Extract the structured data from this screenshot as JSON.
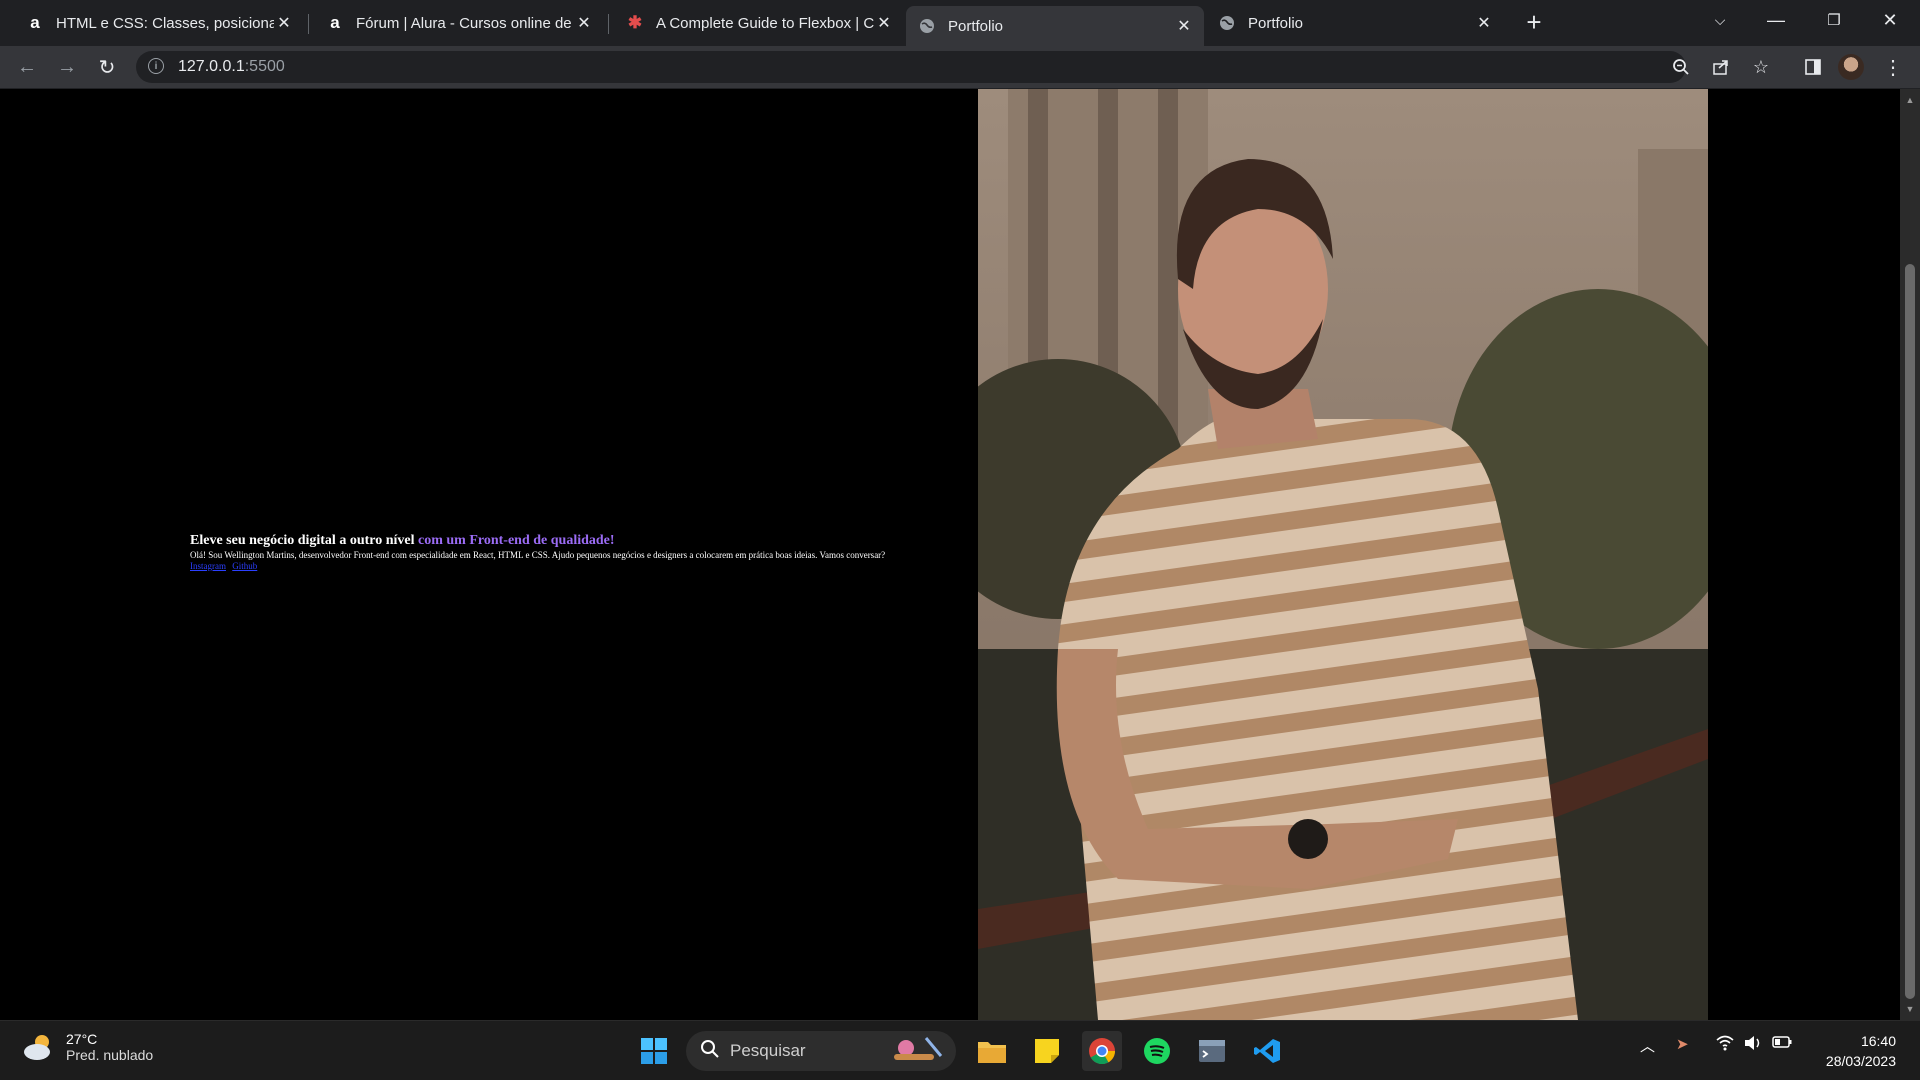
{
  "browser": {
    "tabs": [
      {
        "title": "HTML e CSS: Classes, posicionam",
        "icon": "alura-icon"
      },
      {
        "title": "Fórum | Alura - Cursos online de",
        "icon": "alura-icon"
      },
      {
        "title": "A Complete Guide to Flexbox | C",
        "icon": "css-tricks-icon"
      },
      {
        "title": "Portfolio",
        "icon": "globe-icon",
        "active": true
      },
      {
        "title": "Portfolio",
        "icon": "globe-icon"
      }
    ],
    "address": {
      "host": "127.0.0.1",
      "port": ":5500"
    }
  },
  "page": {
    "hero": {
      "title_main": "Eleve seu negócio digital a outro nível ",
      "title_accent": "com um Front-end de qualidade!",
      "subtitle": "Olá! Sou Wellington Martins, desenvolvedor Front-end com especialidade em React, HTML e CSS. Ajudo pequenos negócios e designers a colocarem em prática boas ideias. Vamos conversar?",
      "links": [
        "Instagram",
        "Github"
      ]
    },
    "photo_alt": "Wellington Martins"
  },
  "taskbar": {
    "weather": {
      "temp": "27°C",
      "condition": "Pred. nublado"
    },
    "search_placeholder": "Pesquisar",
    "time": "16:40",
    "date": "28/03/2023"
  },
  "colors": {
    "accent": "#9b6cf5",
    "link": "#2b3fff"
  }
}
